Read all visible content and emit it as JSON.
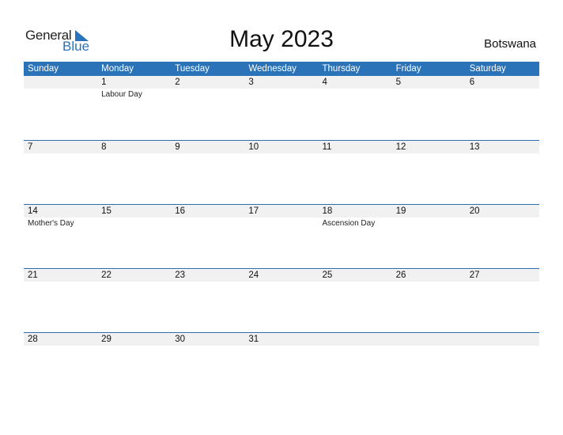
{
  "logo": {
    "word1": "General",
    "word2": "Blue",
    "brand_color": "#2b73b8"
  },
  "title": "May 2023",
  "country": "Botswana",
  "header_color": "#2b73b8",
  "weekdays": [
    "Sunday",
    "Monday",
    "Tuesday",
    "Wednesday",
    "Thursday",
    "Friday",
    "Saturday"
  ],
  "weeks": [
    [
      {
        "day": "",
        "holiday": ""
      },
      {
        "day": "1",
        "holiday": "Labour Day"
      },
      {
        "day": "2",
        "holiday": ""
      },
      {
        "day": "3",
        "holiday": ""
      },
      {
        "day": "4",
        "holiday": ""
      },
      {
        "day": "5",
        "holiday": ""
      },
      {
        "day": "6",
        "holiday": ""
      }
    ],
    [
      {
        "day": "7",
        "holiday": ""
      },
      {
        "day": "8",
        "holiday": ""
      },
      {
        "day": "9",
        "holiday": ""
      },
      {
        "day": "10",
        "holiday": ""
      },
      {
        "day": "11",
        "holiday": ""
      },
      {
        "day": "12",
        "holiday": ""
      },
      {
        "day": "13",
        "holiday": ""
      }
    ],
    [
      {
        "day": "14",
        "holiday": "Mother's Day"
      },
      {
        "day": "15",
        "holiday": ""
      },
      {
        "day": "16",
        "holiday": ""
      },
      {
        "day": "17",
        "holiday": ""
      },
      {
        "day": "18",
        "holiday": "Ascension Day"
      },
      {
        "day": "19",
        "holiday": ""
      },
      {
        "day": "20",
        "holiday": ""
      }
    ],
    [
      {
        "day": "21",
        "holiday": ""
      },
      {
        "day": "22",
        "holiday": ""
      },
      {
        "day": "23",
        "holiday": ""
      },
      {
        "day": "24",
        "holiday": ""
      },
      {
        "day": "25",
        "holiday": ""
      },
      {
        "day": "26",
        "holiday": ""
      },
      {
        "day": "27",
        "holiday": ""
      }
    ],
    [
      {
        "day": "28",
        "holiday": ""
      },
      {
        "day": "29",
        "holiday": ""
      },
      {
        "day": "30",
        "holiday": ""
      },
      {
        "day": "31",
        "holiday": ""
      },
      {
        "day": "",
        "holiday": ""
      },
      {
        "day": "",
        "holiday": ""
      },
      {
        "day": "",
        "holiday": ""
      }
    ]
  ]
}
